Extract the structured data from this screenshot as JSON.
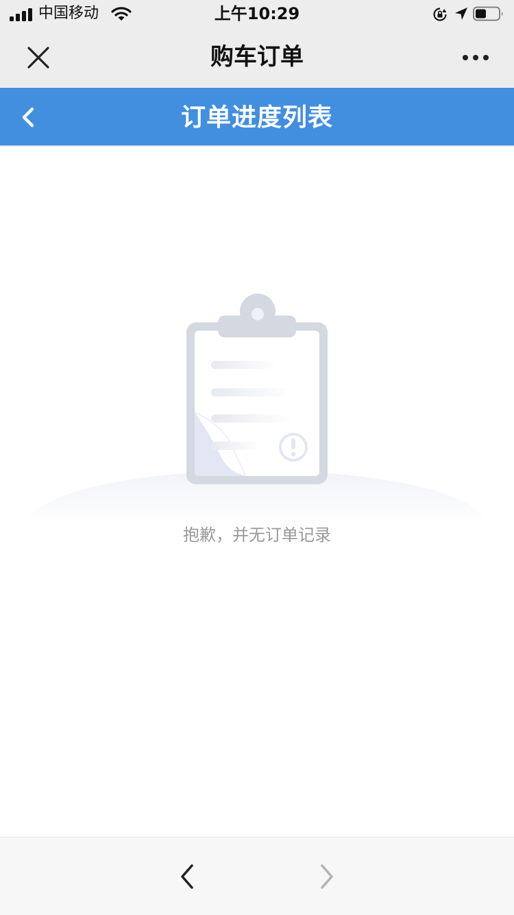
{
  "status_bar": {
    "carrier": "中国移动",
    "time": "上午10:29",
    "icons": [
      "signal-icon",
      "wifi-icon",
      "orientation-lock-icon",
      "location-arrow-icon",
      "battery-icon"
    ]
  },
  "app_header": {
    "title": "购车订单",
    "icons": [
      "close-icon",
      "more-icon"
    ]
  },
  "page_nav": {
    "title": "订单进度列表",
    "accent_color": "#428edf",
    "icons": [
      "back-chevron-icon"
    ]
  },
  "empty_state": {
    "message": "抱歉，并无订单记录",
    "icons": [
      "empty-clipboard-icon"
    ]
  },
  "bottom_bar": {
    "icons": [
      "nav-back-icon",
      "nav-forward-icon"
    ],
    "forward_enabled": "false"
  }
}
